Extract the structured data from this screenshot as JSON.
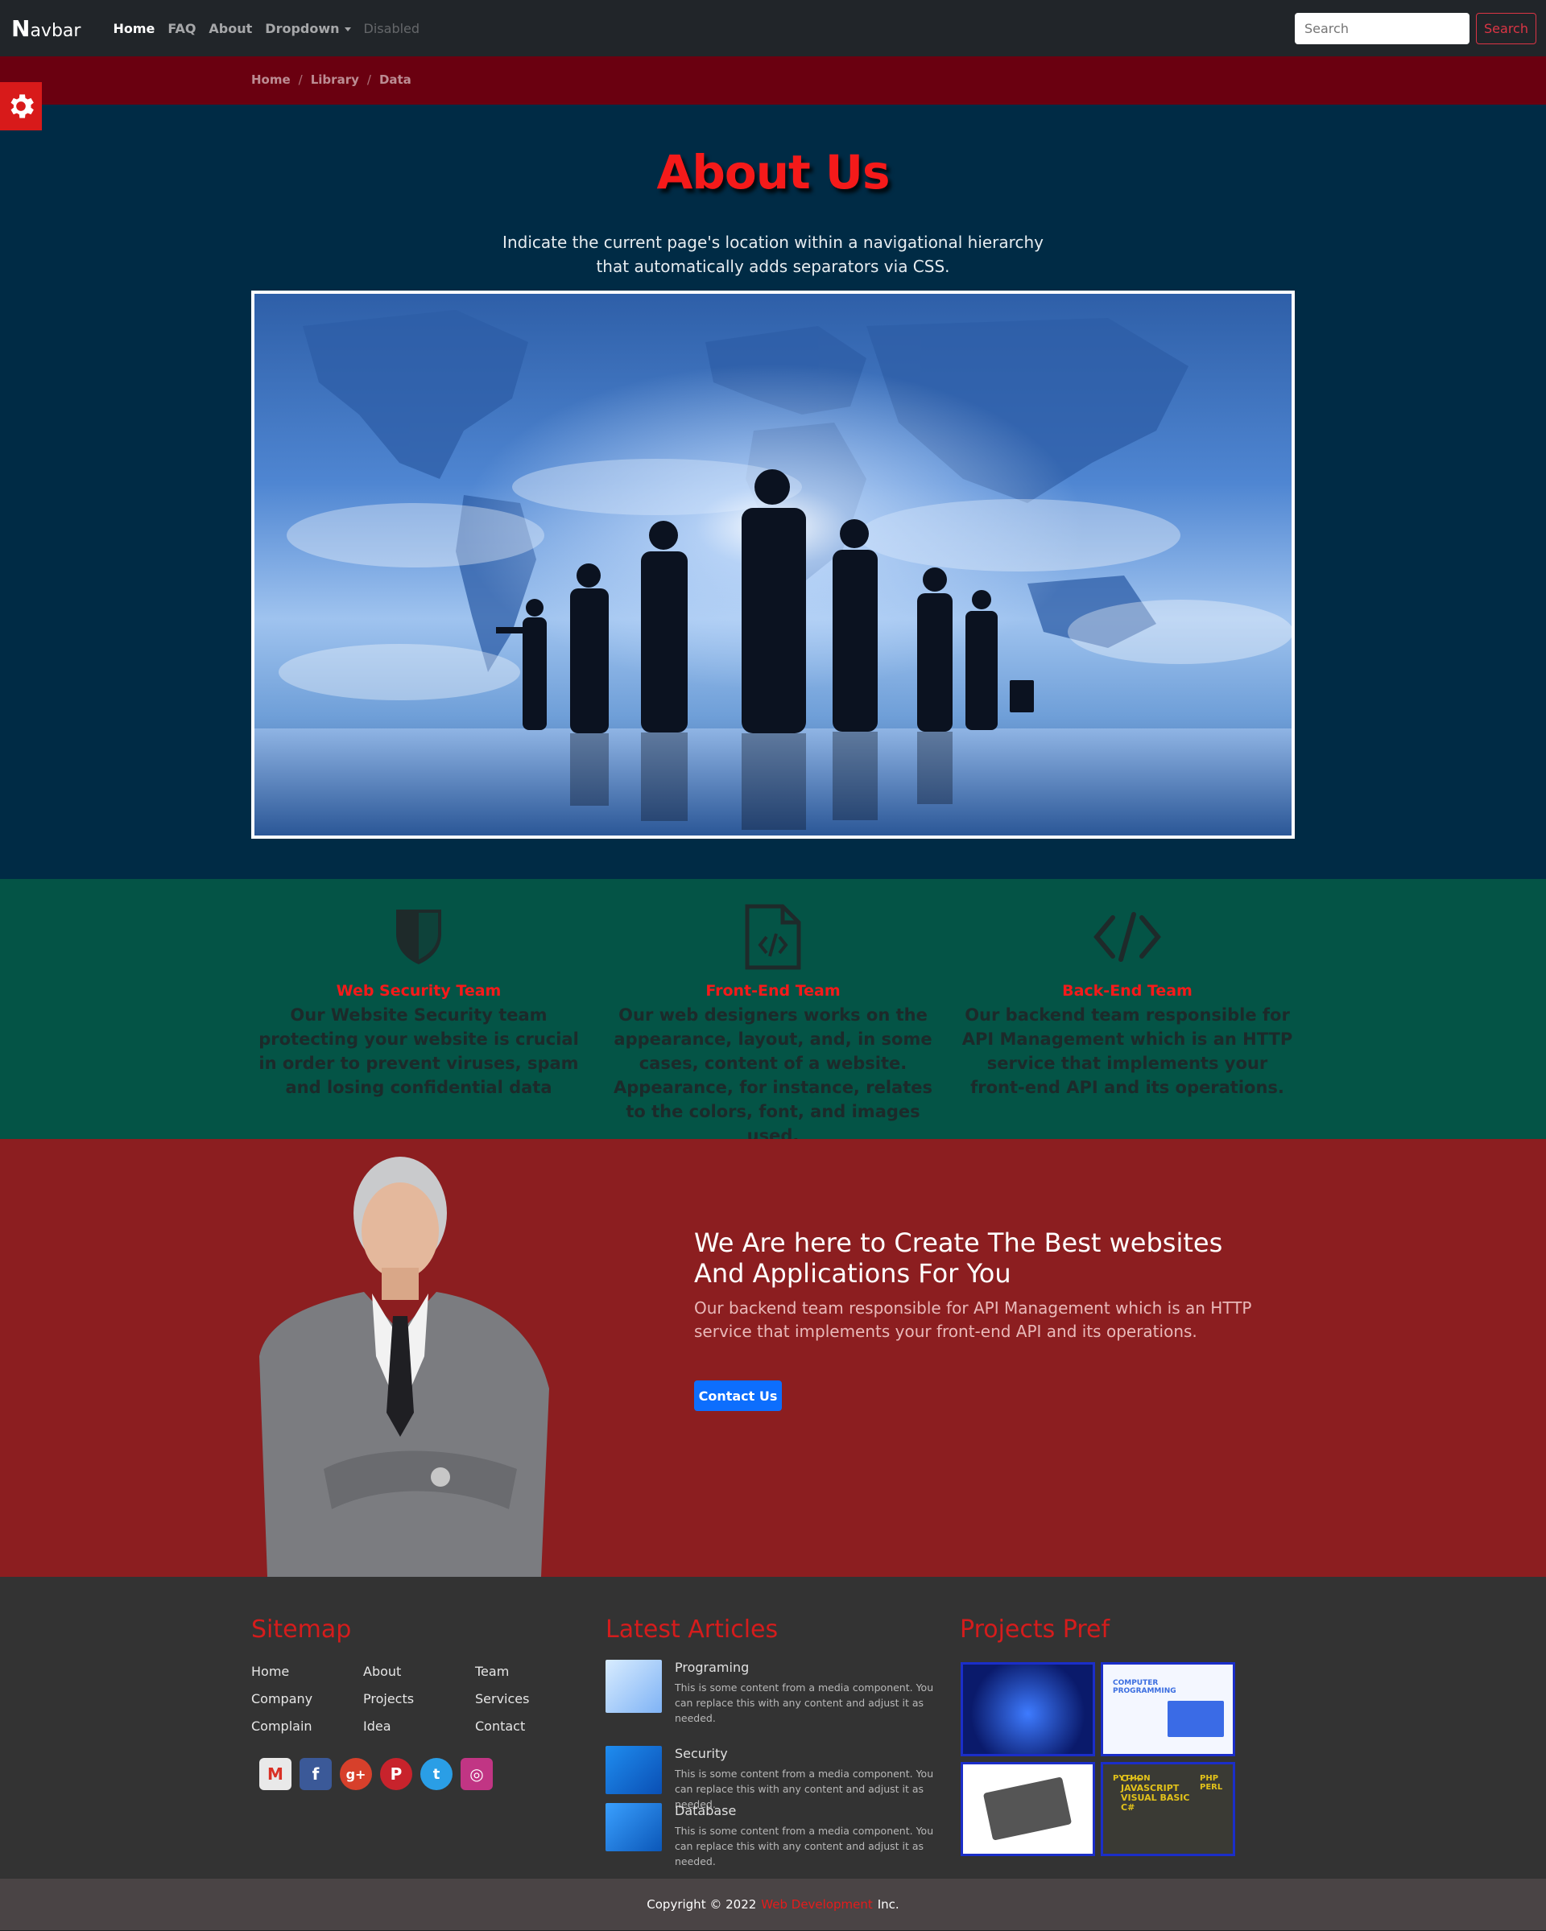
{
  "navbar": {
    "brand_initial": "N",
    "brand_rest": "avbar",
    "links": [
      "Home",
      "FAQ",
      "About",
      "Dropdown",
      "Disabled"
    ],
    "search_placeholder": "Search",
    "search_button": "Search"
  },
  "breadcrumb": [
    "Home",
    "Library",
    "Data"
  ],
  "hero": {
    "title": "About Us",
    "subtitle_line1": "Indicate the current page's location within a navigational hierarchy",
    "subtitle_line2": "that automatically adds separators via CSS."
  },
  "teams": [
    {
      "title": "Web Security Team",
      "text": "Our Website Security team protecting your website is crucial in order to prevent viruses, spam and losing confidential data",
      "icon": "shield-icon"
    },
    {
      "title": "Front-End Team",
      "text": "Our web designers works on the appearance, layout, and, in some cases, content of a website. Appearance, for instance, relates to the colors, font, and images used.",
      "icon": "file-code-icon"
    },
    {
      "title": "Back-End Team",
      "text": "Our backend team responsible for API Management which is an HTTP service that implements your front-end API and its operations.",
      "icon": "code-icon"
    }
  ],
  "cta": {
    "heading": "We Are here to Create The Best websites And Applications For You",
    "text": "Our backend team responsible for API Management which is an HTTP service that implements your front-end API and its operations.",
    "button": "Contact Us"
  },
  "footer": {
    "sitemap_title": "Sitemap",
    "sitemap_links": [
      "Home",
      "About",
      "Team",
      "Company",
      "Projects",
      "Services",
      "Complain",
      "Idea",
      "Contact"
    ],
    "articles_title": "Latest Articles",
    "articles": [
      {
        "title": "Programing",
        "text": "This is some content from a media component. You can replace this with any content and adjust it as needed."
      },
      {
        "title": "Security",
        "text": "This is some content from a media component. You can replace this with any content and adjust it as needed."
      },
      {
        "title": "Database",
        "text": "This is some content from a media component. You can replace this with any content and adjust it as needed."
      }
    ],
    "projects_title": "Projects Pref",
    "projects": [
      "project-1",
      "project-2",
      "project-3",
      "project-4"
    ],
    "project_thumb_text": {
      "p2": "COMPUTER PROGRAMMING",
      "p4_1": "PYTHON",
      "p4_2": "C++",
      "p4_3": "JAVASCRIPT",
      "p4_4": "VISUAL BASIC",
      "p4_5": "PHP",
      "p4_6": "PERL",
      "p4_7": "C#"
    },
    "social": [
      "gmail-icon",
      "facebook-icon",
      "google-plus-icon",
      "pinterest-icon",
      "twitter-icon",
      "instagram-icon"
    ]
  },
  "copyright": {
    "prefix": "Copyright © 2022",
    "brand": "Web Development",
    "suffix": "Inc."
  },
  "colors": {
    "accent": "#f51a1a",
    "hero_bg": "#002b45",
    "team_bg": "#045446",
    "cta_bg": "#8c1e20",
    "footer_bg": "#333333"
  }
}
